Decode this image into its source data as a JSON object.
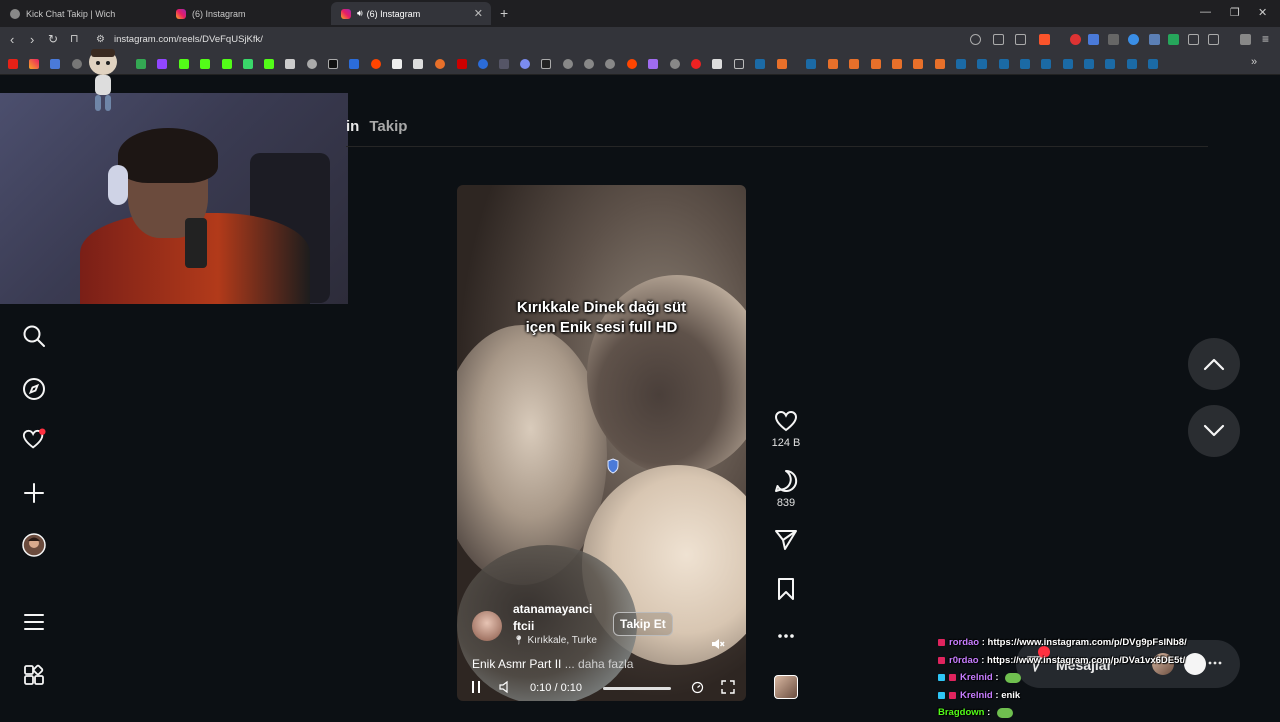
{
  "browser": {
    "tabs": [
      {
        "title": "Kick Chat Takip | Wich",
        "active": false
      },
      {
        "title": "(6) Instagram",
        "active": false
      },
      {
        "title": "(6) Instagram",
        "active": true
      }
    ],
    "url": "instagram.com/reels/DVeFqUSjKfk/"
  },
  "page": {
    "nav_tab_partial": "in",
    "nav_tab_takip": "Takip"
  },
  "reel": {
    "caption_line1": "Kırıkkale Dinek dağı süt",
    "caption_line2": "içen Enik sesi full HD",
    "author_line1": "atanamayanci",
    "author_line2": "ftcii",
    "location": "Kırıkkale, Turke",
    "follow_label": "Takip Et",
    "description": "Enik Asmr Part II",
    "more_label": "... daha fazla",
    "time": "0:10 / 0:10",
    "progress": 1.0,
    "likes": "124 B",
    "comments": "839"
  },
  "messages": {
    "label": "Mesajlar"
  },
  "chat": [
    {
      "user": "rordao",
      "sep": " : ",
      "text": "https://www.instagram.com/p/DVg9pFsINb8/",
      "color": "#c77dff",
      "badge": "kick",
      "emote": false
    },
    {
      "user": "r0rdao",
      "sep": " : ",
      "text": "https://www.instagram.com/p/DVa1vx6DE5t/",
      "color": "#c77dff",
      "badge": "kick",
      "emote": false
    },
    {
      "user": "Krelnid",
      "sep": " : ",
      "text": "",
      "color": "#c77dff",
      "badge": "gem",
      "emote": true
    },
    {
      "user": "Krelnid",
      "sep": " : ",
      "text": "enik",
      "color": "#c77dff",
      "badge": "gem",
      "emote": false
    },
    {
      "user": "Bragdown",
      "sep": " : ",
      "text": "",
      "color": "#53fc18",
      "badge": "",
      "emote": true
    }
  ],
  "colors": {
    "background": "#0c1014",
    "notification": "#ff3040",
    "kick_green": "#53fc18"
  }
}
